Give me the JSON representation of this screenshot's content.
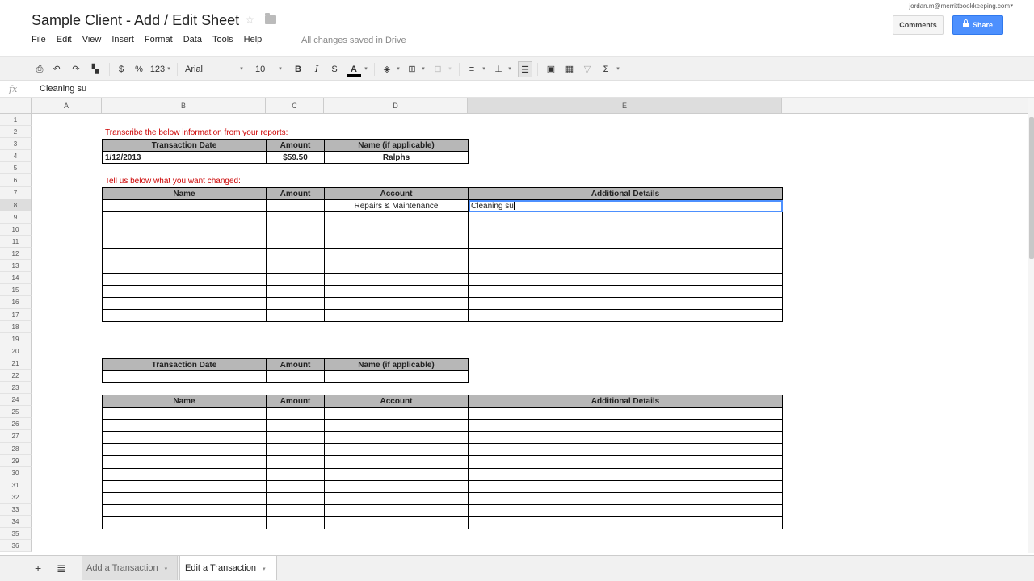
{
  "header": {
    "title": "Sample Client - Add / Edit Sheet",
    "save_status": "All changes saved in Drive",
    "account_email": "jordan.m@merrittbookkeeping.com",
    "comments_label": "Comments",
    "share_label": "Share"
  },
  "menu": [
    "File",
    "Edit",
    "View",
    "Insert",
    "Format",
    "Data",
    "Tools",
    "Help"
  ],
  "toolbar": {
    "currency": "$",
    "percent": "%",
    "number_format": "123",
    "font": "Arial",
    "font_size": "10",
    "bold": "B",
    "italic": "I",
    "strike": "S",
    "font_color": "A",
    "sum": "Σ"
  },
  "formula_bar": {
    "fx": "fx",
    "value": "Cleaning su"
  },
  "columns": [
    "A",
    "B",
    "C",
    "D",
    "E"
  ],
  "rows": [
    "1",
    "2",
    "3",
    "4",
    "5",
    "6",
    "7",
    "8",
    "9",
    "10",
    "11",
    "12",
    "13",
    "14",
    "15",
    "16",
    "17",
    "18",
    "19",
    "20",
    "21",
    "22",
    "23",
    "24",
    "25",
    "26",
    "27",
    "28",
    "29",
    "30",
    "31",
    "32",
    "33",
    "34",
    "35",
    "36"
  ],
  "sheet": {
    "instruction_1": "Transcribe the below information from your reports:",
    "instruction_2": "Tell us below what you want changed:",
    "transaction_headers": [
      "Transaction Date",
      "Amount",
      "Name (if applicable)"
    ],
    "transaction_row": [
      "1/12/2013",
      "$59.50",
      "Ralphs"
    ],
    "change_headers": [
      "Name",
      "Amount",
      "Account",
      "Additional Details"
    ],
    "change_row_1": [
      "",
      "",
      "Repairs & Maintenance",
      "Cleaning su"
    ]
  },
  "sheet_tabs": [
    "Add a Transaction",
    "Edit a Transaction"
  ]
}
